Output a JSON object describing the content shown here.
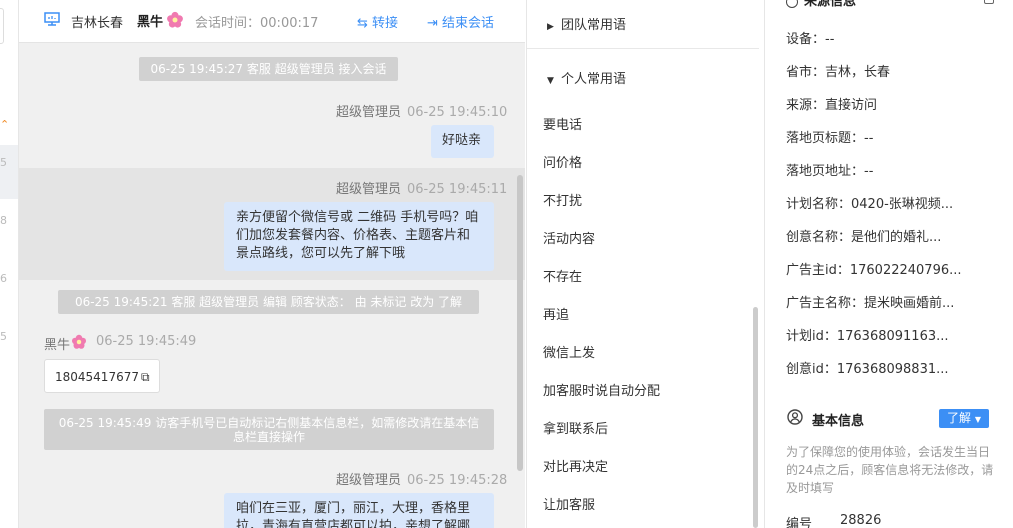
{
  "left_strip": {
    "marks": [
      "5",
      "8",
      "6",
      "5"
    ]
  },
  "chat": {
    "header": {
      "location": "吉林长春",
      "user": "黑牛",
      "duration_label": "会话时间：",
      "duration": "00:00:17",
      "transfer": "转接",
      "end": "结束会话"
    },
    "messages": {
      "sys1": "06-25 19:45:27 客服 超级管理员 接入会话",
      "m1_name": "超级管理员",
      "m1_time": "06-25 19:45:10",
      "m1_text": "好哒亲",
      "m2_name": "超级管理员",
      "m2_time": "06-25 19:45:11",
      "m2_text": "亲方便留个微信号或 二维码 手机号吗？咱们加您发套餐内容、价格表、主题客片和景点路线，您可以先了解下哦",
      "sys2": "06-25 19:45:21 客服 超级管理员 编辑 顾客状态： 由 未标记 改为 了解",
      "v_name": "黑牛",
      "v_time": "06-25 19:45:49",
      "v_phone": "18045417677",
      "sys3": "06-25 19:45:49 访客手机号已自动标记右侧基本信息栏，如需修改请在基本信息栏直接操作",
      "m3_name": "超级管理员",
      "m3_time": "06-25 19:45:28",
      "m3_text": "咱们在三亚，厦门，丽江，大理，香格里拉，青海有直营店都可以拍，亲想了解哪"
    }
  },
  "phrases": {
    "team_group": "团队常用语",
    "personal_group": "个人常用语",
    "items": [
      "要电话",
      "问价格",
      "不打扰",
      "活动内容",
      "不存在",
      "再追",
      "微信上发",
      "加客服时说自动分配",
      "拿到联系后",
      "对比再决定",
      "让加客服"
    ]
  },
  "info": {
    "source_title": "来源信息",
    "device": "设备：--",
    "region": "省市：吉林，长春",
    "source": "来源：直接访问",
    "landing_title": "落地页标题：--",
    "landing_url": "落地页地址：--",
    "plan_name": "计划名称：0420-张琳视频...",
    "creative_name": "创意名称：是他们的婚礼...",
    "advertiser_id": "广告主id：176022240796...",
    "advertiser_name": "广告主名称：提米映画婚前...",
    "plan_id": "计划id：176368091163...",
    "creative_id": "创意id：176368098831...",
    "basic_title": "基本信息",
    "status_tag": "了解",
    "note": "为了保障您的使用体验，会话发生当日的24点之后，顾客信息将无法修改，请及时填写",
    "number_label": "编号",
    "number_value": "28826"
  }
}
